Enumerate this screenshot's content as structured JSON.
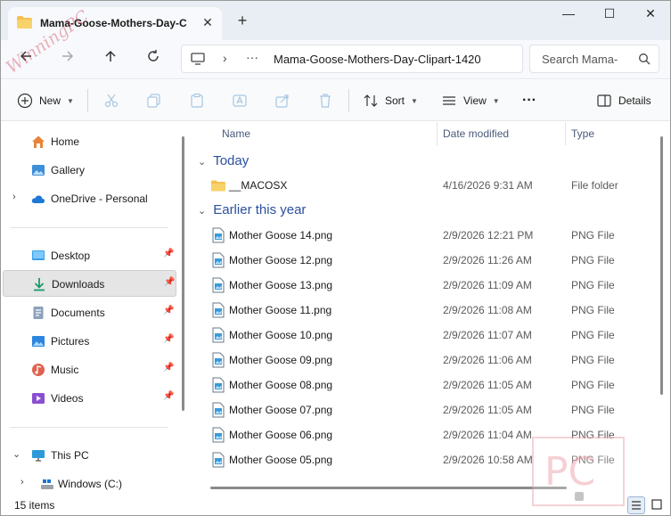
{
  "window": {
    "tab_title": "Mama-Goose-Mothers-Day-C",
    "tab_close": "✕",
    "new_tab": "+",
    "minimize": "—",
    "maximize": "☐",
    "close": "✕"
  },
  "nav": {
    "back_icon": "arrow-left-icon",
    "forward_icon": "arrow-right-icon",
    "up_icon": "arrow-up-icon",
    "refresh_icon": "refresh-icon",
    "address_path": "Mama-Goose-Mothers-Day-Clipart-1420",
    "address_chevron": "›",
    "address_more": "···",
    "search_placeholder": "Search Mama-"
  },
  "commands": {
    "new_label": "New",
    "sort_label": "Sort",
    "view_label": "View",
    "more_label": "···",
    "details_label": "Details"
  },
  "sidebar": {
    "items": [
      {
        "label": "Home",
        "icon": "home-icon"
      },
      {
        "label": "Gallery",
        "icon": "gallery-icon"
      },
      {
        "label": "OneDrive - Personal",
        "icon": "cloud-icon"
      },
      {
        "label": "Desktop",
        "icon": "desktop-icon"
      },
      {
        "label": "Downloads",
        "icon": "download-icon"
      },
      {
        "label": "Documents",
        "icon": "documents-icon"
      },
      {
        "label": "Pictures",
        "icon": "pictures-icon"
      },
      {
        "label": "Music",
        "icon": "music-icon"
      },
      {
        "label": "Videos",
        "icon": "videos-icon"
      },
      {
        "label": "This PC",
        "icon": "pc-icon"
      },
      {
        "label": "Windows (C:)",
        "icon": "drive-icon"
      }
    ],
    "selected": "Downloads"
  },
  "columns": {
    "name": "Name",
    "date": "Date modified",
    "type": "Type"
  },
  "groups": {
    "today": "Today",
    "earlier": "Earlier this year"
  },
  "today_rows": [
    {
      "name": "__MACOSX",
      "date": "4/16/2026 9:31 AM",
      "type": "File folder"
    }
  ],
  "rows": [
    {
      "name": "Mother Goose 14.png",
      "date": "2/9/2026 12:21 PM",
      "type": "PNG File"
    },
    {
      "name": "Mother Goose 12.png",
      "date": "2/9/2026 11:26 AM",
      "type": "PNG File"
    },
    {
      "name": "Mother Goose 13.png",
      "date": "2/9/2026 11:09 AM",
      "type": "PNG File"
    },
    {
      "name": "Mother Goose 11.png",
      "date": "2/9/2026 11:08 AM",
      "type": "PNG File"
    },
    {
      "name": "Mother Goose 10.png",
      "date": "2/9/2026 11:07 AM",
      "type": "PNG File"
    },
    {
      "name": "Mother Goose 09.png",
      "date": "2/9/2026 11:06 AM",
      "type": "PNG File"
    },
    {
      "name": "Mother Goose 08.png",
      "date": "2/9/2026 11:05 AM",
      "type": "PNG File"
    },
    {
      "name": "Mother Goose 07.png",
      "date": "2/9/2026 11:05 AM",
      "type": "PNG File"
    },
    {
      "name": "Mother Goose 06.png",
      "date": "2/9/2026 11:04 AM",
      "type": "PNG File"
    },
    {
      "name": "Mother Goose 05.png",
      "date": "2/9/2026 10:58 AM",
      "type": "PNG File"
    }
  ],
  "status": {
    "item_count": "15 items"
  },
  "watermark": {
    "text": "WinningPC",
    "logo": "PC"
  },
  "colors": {
    "accent": "#0067c0",
    "folder": "#f4c04e",
    "group_heading": "#2b4fa0"
  }
}
